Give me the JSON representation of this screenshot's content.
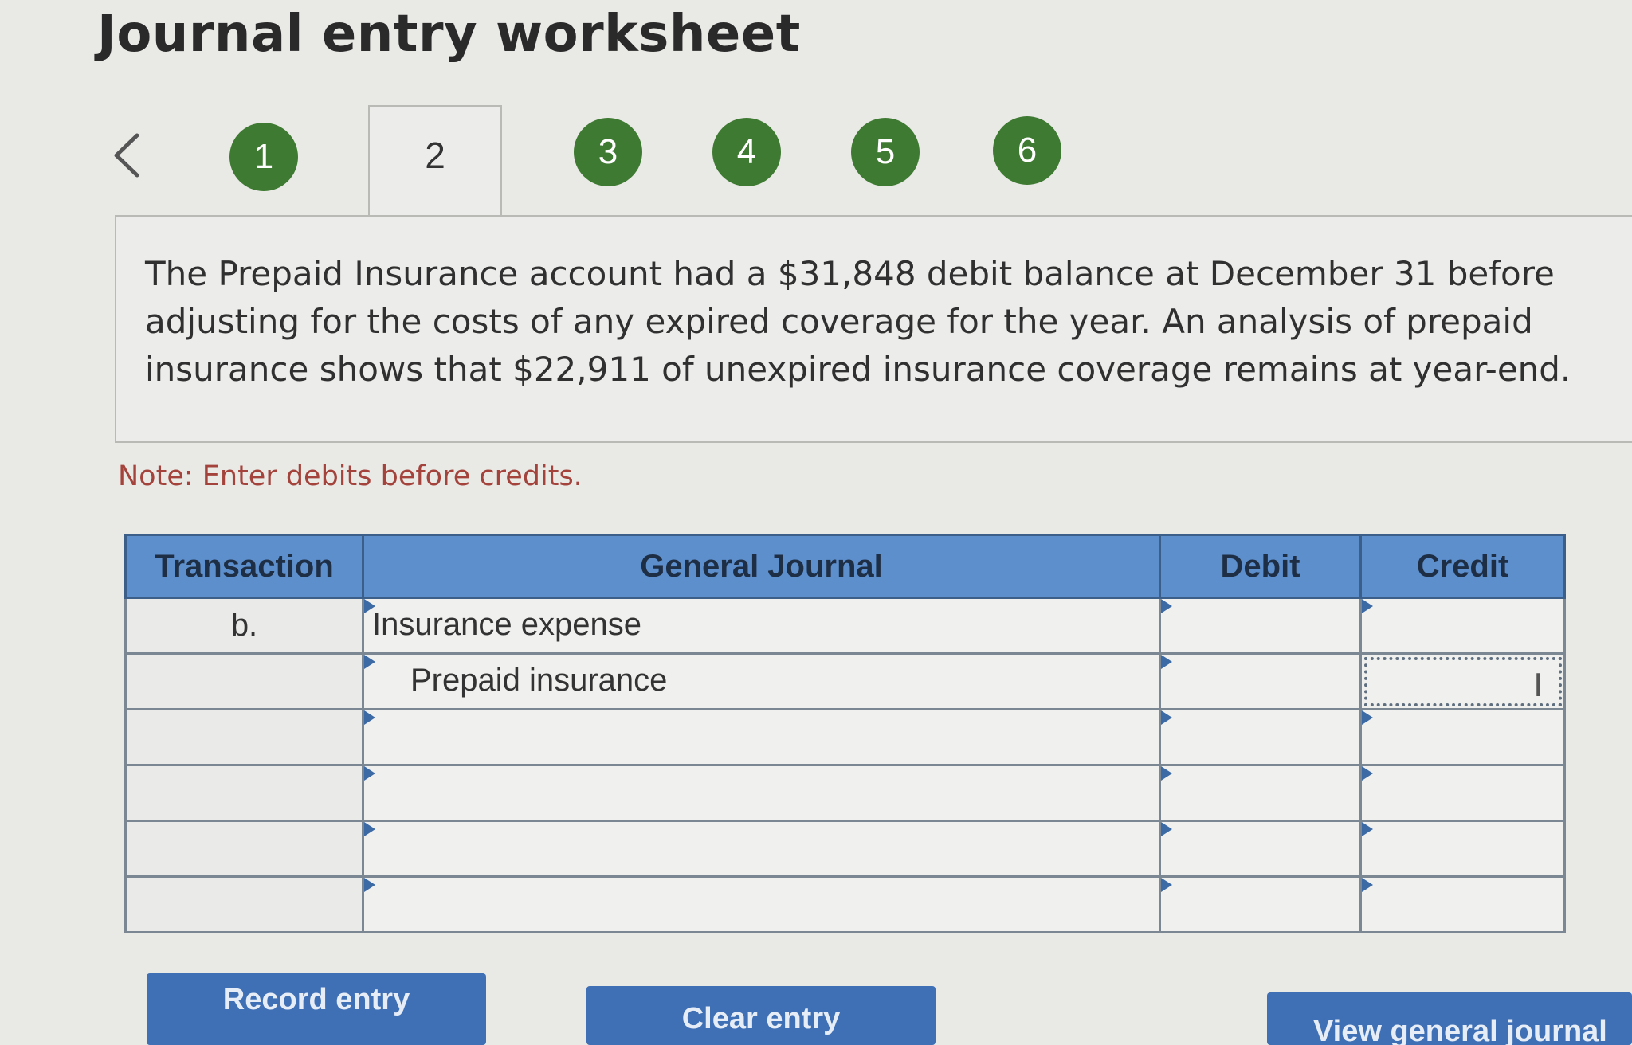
{
  "page": {
    "title": "Journal entry worksheet"
  },
  "tabs": {
    "prev_icon": "chevron-left-icon",
    "items": [
      {
        "label": "1",
        "state": "done"
      },
      {
        "label": "2",
        "state": "active"
      },
      {
        "label": "3",
        "state": "done"
      },
      {
        "label": "4",
        "state": "done"
      },
      {
        "label": "5",
        "state": "done"
      },
      {
        "label": "6",
        "state": "done"
      }
    ],
    "done_color": "#3f7a32"
  },
  "problem": {
    "text": "The Prepaid Insurance account had a $31,848 debit balance at December 31 before adjusting for the costs of any expired coverage for the year. An analysis of prepaid insurance shows that $22,911 of unexpired insurance coverage remains at year-end."
  },
  "note": {
    "text": "Note: Enter debits before credits.",
    "color": "#a3433b"
  },
  "journal": {
    "headers": {
      "transaction": "Transaction",
      "general_journal": "General Journal",
      "debit": "Debit",
      "credit": "Credit"
    },
    "header_color": "#5d8fcd",
    "rows": [
      {
        "transaction": "b.",
        "account": "Insurance expense",
        "debit": "",
        "credit": ""
      },
      {
        "transaction": "",
        "account": "Prepaid insurance",
        "debit": "",
        "credit": ""
      },
      {
        "transaction": "",
        "account": "",
        "debit": "",
        "credit": ""
      },
      {
        "transaction": "",
        "account": "",
        "debit": "",
        "credit": ""
      },
      {
        "transaction": "",
        "account": "",
        "debit": "",
        "credit": ""
      },
      {
        "transaction": "",
        "account": "",
        "debit": "",
        "credit": ""
      }
    ]
  },
  "buttons": {
    "record": "Record entry",
    "clear": "Clear entry",
    "view": "View general journal"
  }
}
